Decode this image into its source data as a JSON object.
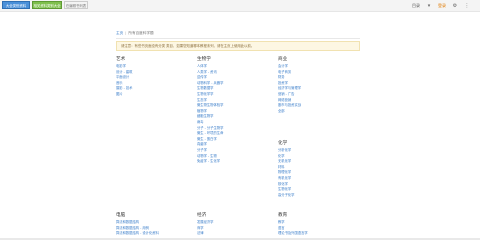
{
  "topbar": {
    "buttons": [
      "大全类别资料",
      "相关资料类别大全",
      "在编辑书列表"
    ],
    "menu_label": "目录",
    "login_label": "登录"
  },
  "breadcrumb": {
    "home": "主页",
    "current": "所有百度科学题"
  },
  "notice": "请注意：有些书页面没有分类 类目，如果您知道哪本教程未列，请在主页上使用此以前。",
  "categories": {
    "arts": {
      "title": "艺术",
      "items": [
        "电影学",
        "设计 - 建筑",
        "平面设计",
        "音乐",
        "摄影 - 技术",
        "图片"
      ]
    },
    "biology": {
      "title": "生物学",
      "items": [
        "人体学",
        "人类学 - 资讯",
        "遗传学",
        "动物科学 - 兵器学",
        "生物数据学",
        "生物化学学",
        "生态学",
        "微生物生物体验学",
        "植物学",
        "细胞生物学",
        "病毒",
        "分子 - 分子生物学",
        "微生 - 环境的生命",
        "微生 - 蛋白学",
        "真菌学",
        "分子学",
        "动物学 - 生物",
        "免疫学 - 生化学"
      ]
    },
    "business": {
      "title": "商业",
      "items": [
        "会计学",
        "电子商务",
        "财务",
        "投资学",
        "经济学与管理学",
        "营销 - 广告",
        "网络营销",
        "股市与投资实战",
        "全部"
      ]
    },
    "chemistry": {
      "title": "化学",
      "items": [
        "分析化学",
        "化学",
        "无机化学",
        "材料",
        "物理化学",
        "有机化学",
        "核化学",
        "生物化学",
        "高分子化学"
      ]
    },
    "computing": {
      "title": "电脑",
      "items": [
        "算法和数据结构",
        "算法和数据结构 - 用例",
        "算法和数据结构 - 设计化资料"
      ]
    },
    "economics": {
      "title": "经济",
      "items": [
        "发展经济学",
        "商学",
        "法律"
      ]
    },
    "education": {
      "title": "教育",
      "items": [
        "教学",
        "语言",
        "理论书及外国语言学"
      ]
    }
  }
}
